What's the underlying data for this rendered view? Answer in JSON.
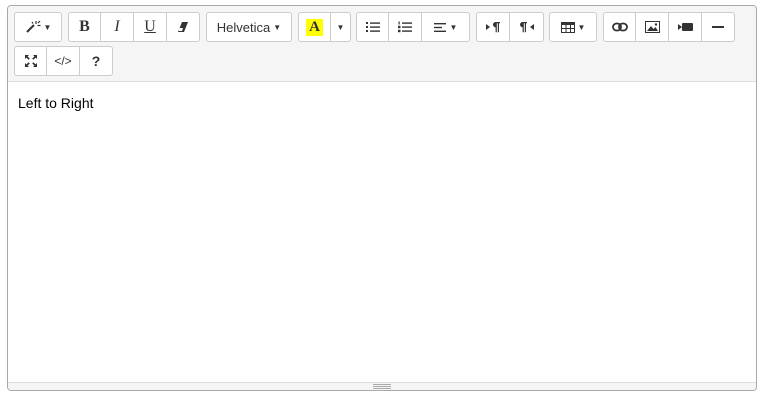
{
  "toolbar": {
    "font_family": "Helvetica",
    "highlight_letter": "A",
    "codeview_label": "</>",
    "help_label": "?",
    "bold_label": "B",
    "italic_label": "I",
    "underline_label": "U"
  },
  "colors": {
    "highlight": "#ffff00",
    "toolbar_bg": "#f5f5f5",
    "border": "#cccccc"
  },
  "content": {
    "text": "Left to Right"
  },
  "icons": [
    "magic-icon",
    "eraser-icon",
    "unordered-list-icon",
    "ordered-list-icon",
    "align-left-icon",
    "ltr-icon",
    "rtl-icon",
    "table-icon",
    "link-icon",
    "picture-icon",
    "video-icon",
    "horizontal-rule-icon",
    "fullscreen-icon",
    "code-icon",
    "help-icon"
  ]
}
